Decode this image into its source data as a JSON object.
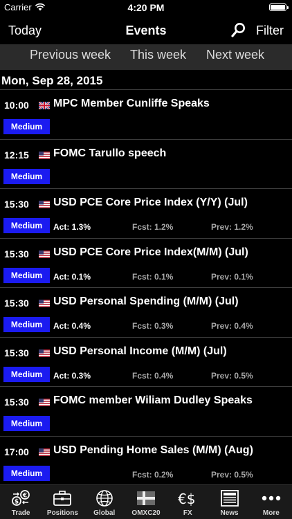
{
  "status_bar": {
    "carrier": "Carrier",
    "time": "4:20 PM",
    "battery_level": 1.0
  },
  "nav": {
    "left_label": "Today",
    "title": "Events",
    "right_label": "Filter"
  },
  "week_tabs": {
    "previous": "Previous week",
    "this": "This week",
    "next": "Next week",
    "selected": "This week"
  },
  "day_header": "Mon, Sep 28, 2015",
  "events": [
    {
      "time": "10:00",
      "flag": "UK",
      "name": "MPC Member Cunliffe Speaks",
      "impact": "Medium",
      "act": "",
      "fcst": "",
      "prev": ""
    },
    {
      "time": "12:15",
      "flag": "US",
      "name": "FOMC Tarullo speech",
      "impact": "Medium",
      "act": "",
      "fcst": "",
      "prev": ""
    },
    {
      "time": "15:30",
      "flag": "US",
      "name": "USD PCE Core Price Index (Y/Y) (Jul)",
      "impact": "Medium",
      "act": "Act: 1.3%",
      "fcst": "Fcst: 1.2%",
      "prev": "Prev: 1.2%"
    },
    {
      "time": "15:30",
      "flag": "US",
      "name": "USD PCE Core Price Index(M/M) (Jul)",
      "impact": "Medium",
      "act": "Act: 0.1%",
      "fcst": "Fcst: 0.1%",
      "prev": "Prev: 0.1%"
    },
    {
      "time": "15:30",
      "flag": "US",
      "name": "USD Personal Spending (M/M) (Jul)",
      "impact": "Medium",
      "act": "Act: 0.4%",
      "fcst": "Fcst: 0.3%",
      "prev": "Prev: 0.4%"
    },
    {
      "time": "15:30",
      "flag": "US",
      "name": "USD Personal Income (M/M) (Jul)",
      "impact": "Medium",
      "act": "Act: 0.3%",
      "fcst": "Fcst: 0.4%",
      "prev": "Prev: 0.5%"
    },
    {
      "time": "15:30",
      "flag": "US",
      "name": "FOMC member Wiliam Dudley Speaks",
      "impact": "Medium",
      "act": "",
      "fcst": "",
      "prev": ""
    },
    {
      "time": "17:00",
      "flag": "US",
      "name": "USD Pending Home Sales (M/M) (Aug)",
      "impact": "Medium",
      "act": "",
      "fcst": "Fcst: 0.2%",
      "prev": "Prev: 0.5%"
    }
  ],
  "tabs": [
    {
      "label": "Trade",
      "icon": "trade-icon"
    },
    {
      "label": "Positions",
      "icon": "briefcase-icon"
    },
    {
      "label": "Global",
      "icon": "globe-icon"
    },
    {
      "label": "OMXC20",
      "icon": "danish-flag-icon"
    },
    {
      "label": "FX",
      "icon": "currency-icon"
    },
    {
      "label": "News",
      "icon": "newspaper-icon"
    },
    {
      "label": "More",
      "icon": "more-dots-icon"
    }
  ],
  "colors": {
    "impact_medium": "#1b1bf0",
    "background": "#000000",
    "week_bar": "#2b2b2b",
    "tab_bar": "#1a1a1a"
  }
}
